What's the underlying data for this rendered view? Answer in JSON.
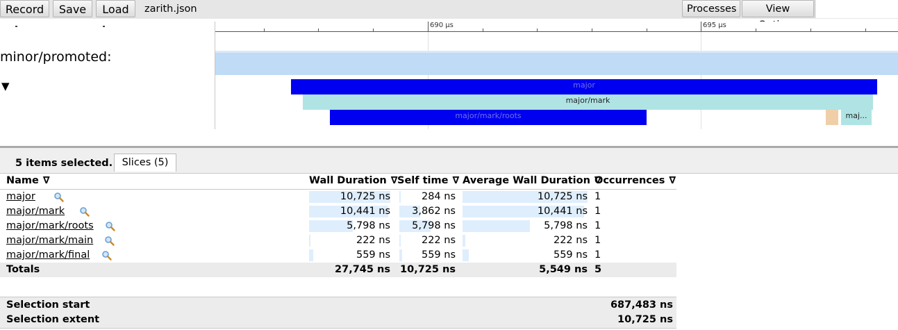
{
  "toolbar": {
    "record_label": "Record",
    "save_label": "Save",
    "load_label": "Load",
    "filename": "zarith.json",
    "processes_label": "Processes",
    "view_options_label": "View Options"
  },
  "ruler": {
    "tick_690": "690 µs",
    "tick_695": "695 µs"
  },
  "tracks": {
    "counter_label": "minor/promoted:",
    "expand_glyph": "▼",
    "slices": [
      {
        "label": "major",
        "color": "#0000f0"
      },
      {
        "label": "major/mark",
        "color": "#b0e4e4"
      },
      {
        "label": "major/mark/roots",
        "color": "#0000f0"
      },
      {
        "label": "",
        "color": "#f0cfa8"
      },
      {
        "label": "maj...",
        "color": "#b0e4e4"
      }
    ]
  },
  "panel": {
    "selection_count": "5 items selected.",
    "tab_label": "Slices (5)"
  },
  "table": {
    "headers": {
      "name": "Name",
      "wall": "Wall Duration",
      "self": "Self time",
      "avg": "Average Wall Duration",
      "occ": "Occurrences"
    },
    "filter_glyph": "∇",
    "rows": [
      {
        "name": "major",
        "wall": "10,725 ns",
        "self": "284 ns",
        "avg": "10,725 ns",
        "occ": "1",
        "wall_frac": 1.0,
        "self_frac": 0.026,
        "avg_frac": 1.0
      },
      {
        "name": "major/mark",
        "wall": "10,441 ns",
        "self": "3,862 ns",
        "avg": "10,441 ns",
        "occ": "1",
        "wall_frac": 0.973,
        "self_frac": 0.36,
        "avg_frac": 0.973
      },
      {
        "name": "major/mark/roots",
        "wall": "5,798 ns",
        "self": "5,798 ns",
        "avg": "5,798 ns",
        "occ": "1",
        "wall_frac": 0.541,
        "self_frac": 0.541,
        "avg_frac": 0.541
      },
      {
        "name": "major/mark/main",
        "wall": "222 ns",
        "self": "222 ns",
        "avg": "222 ns",
        "occ": "1",
        "wall_frac": 0.021,
        "self_frac": 0.021,
        "avg_frac": 0.021
      },
      {
        "name": "major/mark/final",
        "wall": "559 ns",
        "self": "559 ns",
        "avg": "559 ns",
        "occ": "1",
        "wall_frac": 0.052,
        "self_frac": 0.052,
        "avg_frac": 0.052
      }
    ],
    "totals": {
      "label": "Totals",
      "wall": "27,745 ns",
      "self": "10,725 ns",
      "avg": "5,549 ns",
      "occ": "5"
    }
  },
  "summary": {
    "start_label": "Selection start",
    "start_value": "687,483 ns",
    "extent_label": "Selection extent",
    "extent_value": "10,725 ns"
  }
}
